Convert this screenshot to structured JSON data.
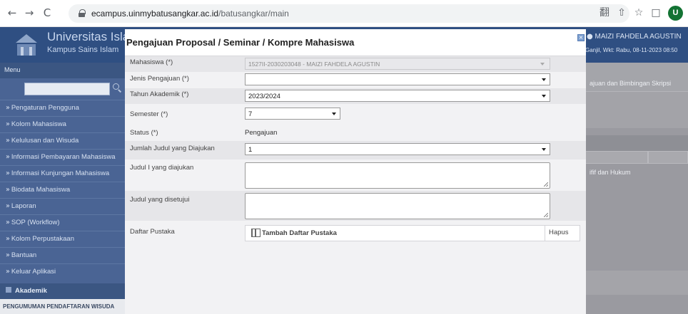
{
  "browser": {
    "back": "←",
    "forward": "→",
    "reload": "C",
    "url_host": "ecampus.uinmybatusangkar.ac.id",
    "url_path": "/batusangkar/main",
    "translate_icon": "翻",
    "share_icon": "⇧",
    "star_icon": "☆",
    "window_icon": "□",
    "profile_initial": "U"
  },
  "app": {
    "university": "Universitas Isla",
    "campus": "Kampus Sains Islam",
    "user": "MAIZI FAHDELA AGUSTIN",
    "semester_info": "Ganjil, Wkt: Rabu, 08-11-2023 08:50"
  },
  "sidebar": {
    "menu_title": "Menu",
    "items": [
      "Pengaturan Pengguna",
      "Kolom Mahasiswa",
      "Kelulusan dan Wisuda",
      "Informasi Pembayaran Mahasiswa",
      "Informasi Kunjungan Mahasiswa",
      "Biodata Mahasiswa",
      "Laporan",
      "SOP (Workflow)",
      "Kolom Perpustakaan",
      "Bantuan",
      "Keluar Aplikasi"
    ],
    "section": "Akademik",
    "announcement": "PENGUMUMAN PENDAFTARAN WISUDA"
  },
  "background": {
    "tab_label": "ajuan dan Bimbingan Skripsi",
    "row_text": "ifif dan Hukum"
  },
  "modal": {
    "title": "Pengajuan Proposal / Seminar / Kompre Mahasiswa",
    "close": "×",
    "fields": {
      "mahasiswa_label": "Mahasiswa (*)",
      "mahasiswa_value": "1527II-2030203048 - MAIZI FAHDELA AGUSTIN",
      "jenis_label": "Jenis Pengajuan (*)",
      "jenis_value": "",
      "tahun_label": "Tahun Akademik (*)",
      "tahun_value": "2023/2024",
      "semester_label": "Semester (*)",
      "semester_value": "7",
      "status_label": "Status (*)",
      "status_value": "Pengajuan",
      "jumlah_label": "Jumlah Judul yang Diajukan",
      "jumlah_value": "1",
      "judul_diajukan_label": "Judul I yang diajukan",
      "judul_disetujui_label": "Judul yang disetujui",
      "pustaka_label": "Daftar Pustaka",
      "tambah_label": "Tambah Daftar Pustaka",
      "hapus_label": "Hapus"
    }
  }
}
